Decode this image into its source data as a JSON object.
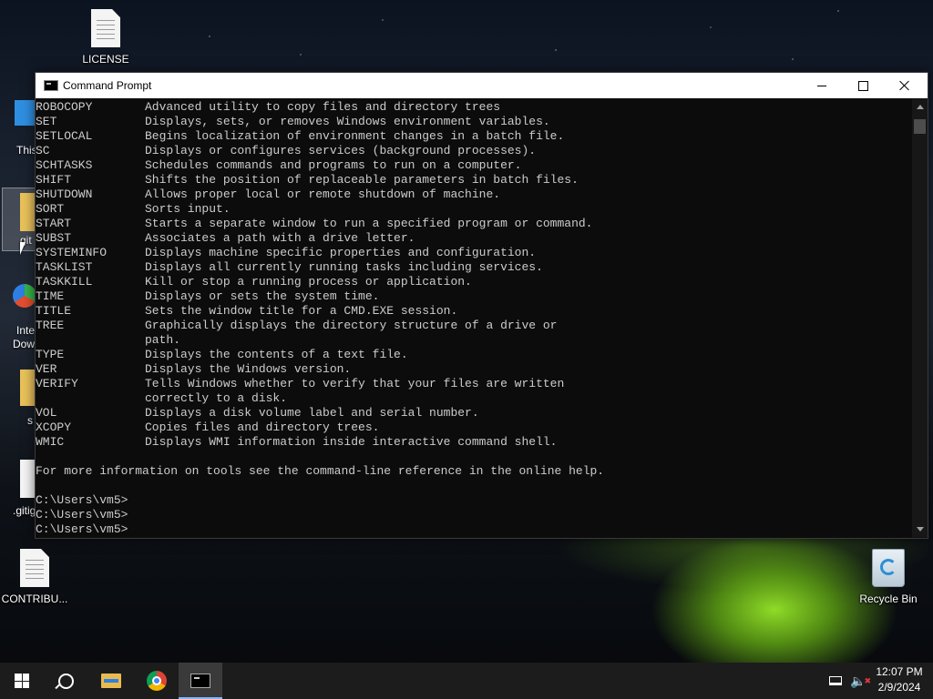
{
  "desktop": {
    "icons": [
      {
        "label": "LICENSE",
        "type": "document"
      },
      {
        "label": "CONTRIBU...",
        "type": "document"
      },
      {
        "label": "Recycle Bin",
        "type": "recycle-bin"
      }
    ],
    "partial_labels": [
      "This",
      "git",
      "Inte",
      "Dow",
      "s",
      ".gitig"
    ]
  },
  "window": {
    "title": "Command Prompt",
    "buttons": [
      "minimize",
      "maximize",
      "close"
    ]
  },
  "console": {
    "commands": [
      {
        "cmd": "ROBOCOPY",
        "desc": "Advanced utility to copy files and directory trees"
      },
      {
        "cmd": "SET",
        "desc": "Displays, sets, or removes Windows environment variables."
      },
      {
        "cmd": "SETLOCAL",
        "desc": "Begins localization of environment changes in a batch file."
      },
      {
        "cmd": "SC",
        "desc": "Displays or configures services (background processes)."
      },
      {
        "cmd": "SCHTASKS",
        "desc": "Schedules commands and programs to run on a computer."
      },
      {
        "cmd": "SHIFT",
        "desc": "Shifts the position of replaceable parameters in batch files."
      },
      {
        "cmd": "SHUTDOWN",
        "desc": "Allows proper local or remote shutdown of machine."
      },
      {
        "cmd": "SORT",
        "desc": "Sorts input."
      },
      {
        "cmd": "START",
        "desc": "Starts a separate window to run a specified program or command."
      },
      {
        "cmd": "SUBST",
        "desc": "Associates a path with a drive letter."
      },
      {
        "cmd": "SYSTEMINFO",
        "desc": "Displays machine specific properties and configuration."
      },
      {
        "cmd": "TASKLIST",
        "desc": "Displays all currently running tasks including services."
      },
      {
        "cmd": "TASKKILL",
        "desc": "Kill or stop a running process or application."
      },
      {
        "cmd": "TIME",
        "desc": "Displays or sets the system time."
      },
      {
        "cmd": "TITLE",
        "desc": "Sets the window title for a CMD.EXE session."
      },
      {
        "cmd": "TREE",
        "desc": "Graphically displays the directory structure of a drive or"
      },
      {
        "cmd": "",
        "desc": "path."
      },
      {
        "cmd": "TYPE",
        "desc": "Displays the contents of a text file."
      },
      {
        "cmd": "VER",
        "desc": "Displays the Windows version."
      },
      {
        "cmd": "VERIFY",
        "desc": "Tells Windows whether to verify that your files are written"
      },
      {
        "cmd": "",
        "desc": "correctly to a disk."
      },
      {
        "cmd": "VOL",
        "desc": "Displays a disk volume label and serial number."
      },
      {
        "cmd": "XCOPY",
        "desc": "Copies files and directory trees."
      },
      {
        "cmd": "WMIC",
        "desc": "Displays WMI information inside interactive command shell."
      }
    ],
    "footer": "For more information on tools see the command-line reference in the online help.",
    "prompts": [
      "C:\\Users\\vm5>",
      "C:\\Users\\vm5>",
      "C:\\Users\\vm5>"
    ]
  },
  "taskbar": {
    "items": [
      "start",
      "search",
      "file-explorer",
      "chrome",
      "command-prompt"
    ],
    "clock": {
      "time": "12:07 PM",
      "date": "2/9/2024"
    }
  }
}
